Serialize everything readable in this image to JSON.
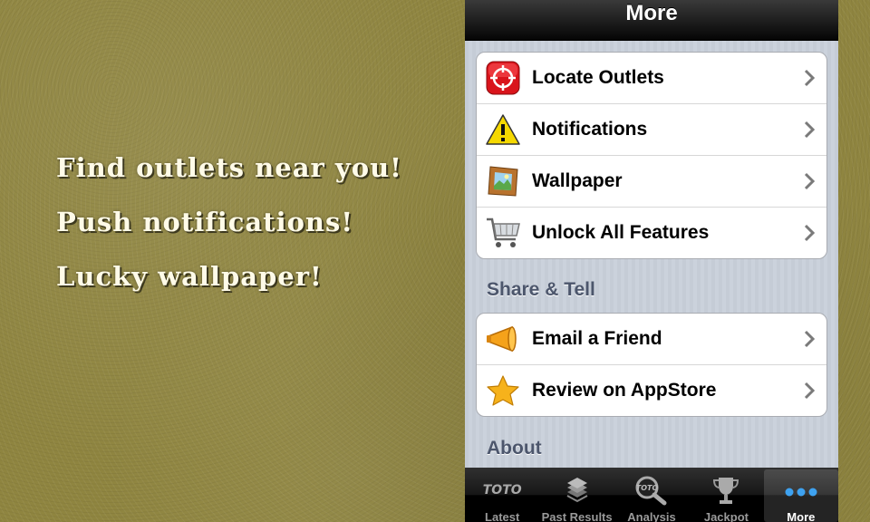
{
  "promo": {
    "line1": "Find outlets near you!",
    "line2": "Push notifications!",
    "line3": "Lucky wallpaper!"
  },
  "navbar": {
    "title": "More"
  },
  "group1": {
    "items": [
      {
        "label": "Locate Outlets",
        "icon": "crosshair-icon"
      },
      {
        "label": "Notifications",
        "icon": "warning-icon"
      },
      {
        "label": "Wallpaper",
        "icon": "picture-frame-icon"
      },
      {
        "label": "Unlock All Features",
        "icon": "shopping-cart-icon"
      }
    ]
  },
  "section_share": "Share & Tell",
  "group2": {
    "items": [
      {
        "label": "Email a Friend",
        "icon": "megaphone-icon"
      },
      {
        "label": "Review on AppStore",
        "icon": "star-icon"
      }
    ]
  },
  "section_about": "About",
  "tabbar": {
    "tabs": [
      {
        "label": "Latest",
        "icon_text": "TOTO"
      },
      {
        "label": "Past Results"
      },
      {
        "label": "Analysis",
        "icon_text": "TOTO"
      },
      {
        "label": "Jackpot"
      },
      {
        "label": "More",
        "selected": true
      }
    ]
  },
  "colors": {
    "background": "#8f8540",
    "section_header": "#4c566c",
    "accent_blue": "#3ea2f0"
  }
}
